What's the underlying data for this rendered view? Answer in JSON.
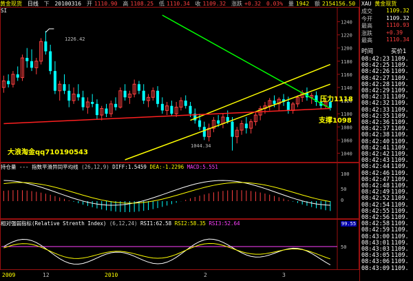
{
  "header": {
    "name": "黄金现货",
    "period": "日线",
    "fq": "下",
    "date": "20100316",
    "open_label": "开",
    "open": "1110.90",
    "high_label": "高",
    "high": "1108.25",
    "low_label": "低",
    "low": "1110.34",
    "close_label": "收",
    "close": "1109.32",
    "chg_label": "涨跌",
    "chg": "+0.32",
    "pct": "0.03%",
    "vol_label": "量",
    "vol": "1942",
    "amount_label": "额",
    "amount": "2154156.50"
  },
  "main_panel": {
    "indicator_label": "SI",
    "annotations": {
      "peak": "1226.42",
      "trough": "1044.34",
      "resistance": "压力1118",
      "support": "支撑1098",
      "ad": "大浪淘金qq710190543"
    }
  },
  "macd_panel": {
    "title_a": "持仓量",
    "title_b": "--- 指数平滑异同平均线",
    "params": "(26,12,9)",
    "diff_label": "DIFF:",
    "diff": "1.5459",
    "dea_label": "DEA:",
    "dea": "-1.2296",
    "macd_label": "MACD:",
    "macd": "5.551"
  },
  "rsi_panel": {
    "title": "相对强弱指标(Relative Strenth Index)",
    "params": "(6,12,24)",
    "rsi1_label": "RSI1:",
    "rsi1": "62.58",
    "rsi2_label": "RSI2:",
    "rsi2": "58.35",
    "rsi3_label": "RSI3:",
    "rsi3": "52.64",
    "hilite": "99.55"
  },
  "x_axis": {
    "labels": [
      "2009",
      "12",
      "2010",
      "2",
      "3"
    ]
  },
  "right_panel": {
    "code": "XAU",
    "name": "黄金现货",
    "rows": [
      {
        "label": "成交",
        "value": "1109.32",
        "color": "#ffff00"
      },
      {
        "label": "今开",
        "value": "1109.32",
        "color": "#ffffff"
      },
      {
        "label": "最高",
        "value": "1110.93",
        "color": "#ff4040"
      },
      {
        "label": "涨跌",
        "value": "+0.39",
        "color": "#ff4040"
      },
      {
        "label": "最高",
        "value": "1110.34",
        "color": "#ff4040"
      }
    ],
    "tape_head": {
      "time": "时间",
      "price": "买价1"
    },
    "tape": [
      {
        "time": "08:42:23",
        "price": "1109."
      },
      {
        "time": "08:42:25",
        "price": "1109."
      },
      {
        "time": "08:42:26",
        "price": "1109."
      },
      {
        "time": "08:42:27",
        "price": "1109."
      },
      {
        "time": "08:42:28",
        "price": "1109."
      },
      {
        "time": "08:42:29",
        "price": "1109."
      },
      {
        "time": "08:42:31",
        "price": "1109."
      },
      {
        "time": "08:42:32",
        "price": "1109."
      },
      {
        "time": "08:42:33",
        "price": "1109."
      },
      {
        "time": "08:42:35",
        "price": "1109."
      },
      {
        "time": "08:42:36",
        "price": "1109."
      },
      {
        "time": "08:42:37",
        "price": "1109."
      },
      {
        "time": "08:42:38",
        "price": "1109."
      },
      {
        "time": "08:42:40",
        "price": "1109."
      },
      {
        "time": "08:42:41",
        "price": "1109."
      },
      {
        "time": "08:42:42",
        "price": "1109."
      },
      {
        "time": "08:42:43",
        "price": "1109."
      },
      {
        "time": "08:42:44",
        "price": "1109."
      },
      {
        "time": "08:42:46",
        "price": "1109."
      },
      {
        "time": "08:42:47",
        "price": "1109."
      },
      {
        "time": "08:42:48",
        "price": "1109."
      },
      {
        "time": "08:42:49",
        "price": "1109."
      },
      {
        "time": "08:42:52",
        "price": "1109."
      },
      {
        "time": "08:42:54",
        "price": "1109."
      },
      {
        "time": "08:42:55",
        "price": "1109."
      },
      {
        "time": "08:42:56",
        "price": "1109."
      },
      {
        "time": "08:42:58",
        "price": "1109."
      },
      {
        "time": "08:42:59",
        "price": "1109."
      },
      {
        "time": "08:43:00",
        "price": "1109."
      },
      {
        "time": "08:43:01",
        "price": "1109."
      },
      {
        "time": "08:43:03",
        "price": "1109."
      },
      {
        "time": "08:43:05",
        "price": "1109."
      },
      {
        "time": "08:43:06",
        "price": "1109."
      },
      {
        "time": "08:43:09",
        "price": "1109."
      }
    ]
  },
  "chart_data": [
    {
      "type": "candlestick",
      "title": "黄金现货 日线",
      "ylim": [
        1030,
        1250
      ],
      "y_ticks": [
        1240,
        1220,
        1200,
        1180,
        1160,
        1140,
        1120,
        1100,
        1080,
        1060,
        1040
      ],
      "candles": [
        {
          "o": 1140,
          "h": 1158,
          "l": 1132,
          "c": 1150
        },
        {
          "o": 1150,
          "h": 1160,
          "l": 1140,
          "c": 1145
        },
        {
          "o": 1145,
          "h": 1165,
          "l": 1140,
          "c": 1160
        },
        {
          "o": 1160,
          "h": 1172,
          "l": 1150,
          "c": 1155
        },
        {
          "o": 1155,
          "h": 1190,
          "l": 1150,
          "c": 1185
        },
        {
          "o": 1185,
          "h": 1200,
          "l": 1170,
          "c": 1180
        },
        {
          "o": 1180,
          "h": 1198,
          "l": 1165,
          "c": 1170
        },
        {
          "o": 1170,
          "h": 1185,
          "l": 1160,
          "c": 1180
        },
        {
          "o": 1180,
          "h": 1215,
          "l": 1175,
          "c": 1210
        },
        {
          "o": 1210,
          "h": 1226,
          "l": 1190,
          "c": 1195
        },
        {
          "o": 1195,
          "h": 1205,
          "l": 1160,
          "c": 1165
        },
        {
          "o": 1165,
          "h": 1180,
          "l": 1130,
          "c": 1135
        },
        {
          "o": 1135,
          "h": 1150,
          "l": 1120,
          "c": 1145
        },
        {
          "o": 1145,
          "h": 1160,
          "l": 1130,
          "c": 1135
        },
        {
          "o": 1135,
          "h": 1145,
          "l": 1110,
          "c": 1120
        },
        {
          "o": 1120,
          "h": 1140,
          "l": 1115,
          "c": 1130
        },
        {
          "o": 1130,
          "h": 1145,
          "l": 1120,
          "c": 1125
        },
        {
          "o": 1125,
          "h": 1135,
          "l": 1105,
          "c": 1110
        },
        {
          "o": 1110,
          "h": 1125,
          "l": 1100,
          "c": 1118
        },
        {
          "o": 1118,
          "h": 1130,
          "l": 1110,
          "c": 1115
        },
        {
          "o": 1115,
          "h": 1122,
          "l": 1092,
          "c": 1098
        },
        {
          "o": 1098,
          "h": 1112,
          "l": 1090,
          "c": 1108
        },
        {
          "o": 1108,
          "h": 1115,
          "l": 1095,
          "c": 1100
        },
        {
          "o": 1100,
          "h": 1120,
          "l": 1095,
          "c": 1115
        },
        {
          "o": 1115,
          "h": 1125,
          "l": 1105,
          "c": 1110
        },
        {
          "o": 1110,
          "h": 1140,
          "l": 1108,
          "c": 1135
        },
        {
          "o": 1135,
          "h": 1145,
          "l": 1120,
          "c": 1125
        },
        {
          "o": 1125,
          "h": 1135,
          "l": 1115,
          "c": 1130
        },
        {
          "o": 1130,
          "h": 1152,
          "l": 1125,
          "c": 1145
        },
        {
          "o": 1145,
          "h": 1150,
          "l": 1130,
          "c": 1135
        },
        {
          "o": 1135,
          "h": 1145,
          "l": 1115,
          "c": 1120
        },
        {
          "o": 1120,
          "h": 1130,
          "l": 1110,
          "c": 1125
        },
        {
          "o": 1125,
          "h": 1140,
          "l": 1120,
          "c": 1135
        },
        {
          "o": 1135,
          "h": 1142,
          "l": 1110,
          "c": 1115
        },
        {
          "o": 1115,
          "h": 1125,
          "l": 1100,
          "c": 1105
        },
        {
          "o": 1105,
          "h": 1118,
          "l": 1098,
          "c": 1112
        },
        {
          "o": 1112,
          "h": 1120,
          "l": 1096,
          "c": 1100
        },
        {
          "o": 1100,
          "h": 1118,
          "l": 1095,
          "c": 1110
        },
        {
          "o": 1110,
          "h": 1125,
          "l": 1105,
          "c": 1120
        },
        {
          "o": 1120,
          "h": 1128,
          "l": 1108,
          "c": 1112
        },
        {
          "o": 1112,
          "h": 1118,
          "l": 1095,
          "c": 1100
        },
        {
          "o": 1100,
          "h": 1108,
          "l": 1085,
          "c": 1090
        },
        {
          "o": 1090,
          "h": 1100,
          "l": 1075,
          "c": 1080
        },
        {
          "o": 1080,
          "h": 1088,
          "l": 1060,
          "c": 1065
        },
        {
          "o": 1065,
          "h": 1085,
          "l": 1058,
          "c": 1078
        },
        {
          "o": 1078,
          "h": 1095,
          "l": 1072,
          "c": 1090
        },
        {
          "o": 1090,
          "h": 1098,
          "l": 1080,
          "c": 1085
        },
        {
          "o": 1085,
          "h": 1100,
          "l": 1078,
          "c": 1095
        },
        {
          "o": 1095,
          "h": 1105,
          "l": 1085,
          "c": 1088
        },
        {
          "o": 1088,
          "h": 1095,
          "l": 1044,
          "c": 1065
        },
        {
          "o": 1065,
          "h": 1080,
          "l": 1055,
          "c": 1075
        },
        {
          "o": 1075,
          "h": 1090,
          "l": 1068,
          "c": 1085
        },
        {
          "o": 1085,
          "h": 1095,
          "l": 1070,
          "c": 1078
        },
        {
          "o": 1078,
          "h": 1092,
          "l": 1070,
          "c": 1088
        },
        {
          "o": 1088,
          "h": 1102,
          "l": 1082,
          "c": 1098
        },
        {
          "o": 1098,
          "h": 1112,
          "l": 1090,
          "c": 1108
        },
        {
          "o": 1108,
          "h": 1118,
          "l": 1100,
          "c": 1112
        },
        {
          "o": 1112,
          "h": 1124,
          "l": 1105,
          "c": 1120
        },
        {
          "o": 1120,
          "h": 1128,
          "l": 1110,
          "c": 1115
        },
        {
          "o": 1115,
          "h": 1125,
          "l": 1105,
          "c": 1122
        },
        {
          "o": 1122,
          "h": 1130,
          "l": 1112,
          "c": 1118
        },
        {
          "o": 1118,
          "h": 1126,
          "l": 1100,
          "c": 1105
        },
        {
          "o": 1105,
          "h": 1118,
          "l": 1100,
          "c": 1115
        },
        {
          "o": 1115,
          "h": 1128,
          "l": 1110,
          "c": 1125
        },
        {
          "o": 1125,
          "h": 1136,
          "l": 1118,
          "c": 1132
        },
        {
          "o": 1132,
          "h": 1140,
          "l": 1120,
          "c": 1125
        },
        {
          "o": 1125,
          "h": 1132,
          "l": 1115,
          "c": 1128
        },
        {
          "o": 1128,
          "h": 1134,
          "l": 1112,
          "c": 1118
        },
        {
          "o": 1118,
          "h": 1125,
          "l": 1108,
          "c": 1112
        },
        {
          "o": 1112,
          "h": 1122,
          "l": 1108,
          "c": 1118
        },
        {
          "o": 1118,
          "h": 1124,
          "l": 1105,
          "c": 1109
        }
      ],
      "trendlines": [
        {
          "name": "resistance",
          "color": "#00ff00",
          "from": [
            34,
            1250
          ],
          "to": [
            70,
            1108
          ]
        },
        {
          "name": "channel-upper",
          "color": "#ffff00",
          "from": [
            40,
            1090
          ],
          "to": [
            70,
            1175
          ]
        },
        {
          "name": "channel-lower",
          "color": "#ffff00",
          "from": [
            26,
            1030
          ],
          "to": [
            70,
            1145
          ]
        },
        {
          "name": "support",
          "color": "#ff2020",
          "from": [
            0,
            1085
          ],
          "to": [
            70,
            1108
          ]
        }
      ]
    },
    {
      "type": "line",
      "title": "指数平滑异同平均线",
      "ylim": [
        -60,
        100
      ],
      "y_ticks": [
        100,
        50,
        0
      ],
      "series": [
        {
          "name": "DIFF",
          "color": "#ffffff"
        },
        {
          "name": "DEA",
          "color": "#ffff00"
        },
        {
          "name": "MACD",
          "color": "#ff40ff"
        }
      ]
    },
    {
      "type": "line",
      "title": "相对强弱指标(Relative Strenth Index)",
      "ylim": [
        0,
        100
      ],
      "y_ticks": [
        50
      ],
      "series": [
        {
          "name": "RSI1",
          "color": "#ffffff"
        },
        {
          "name": "RSI2",
          "color": "#ffff00"
        },
        {
          "name": "RSI3",
          "color": "#ff40ff"
        }
      ]
    }
  ]
}
